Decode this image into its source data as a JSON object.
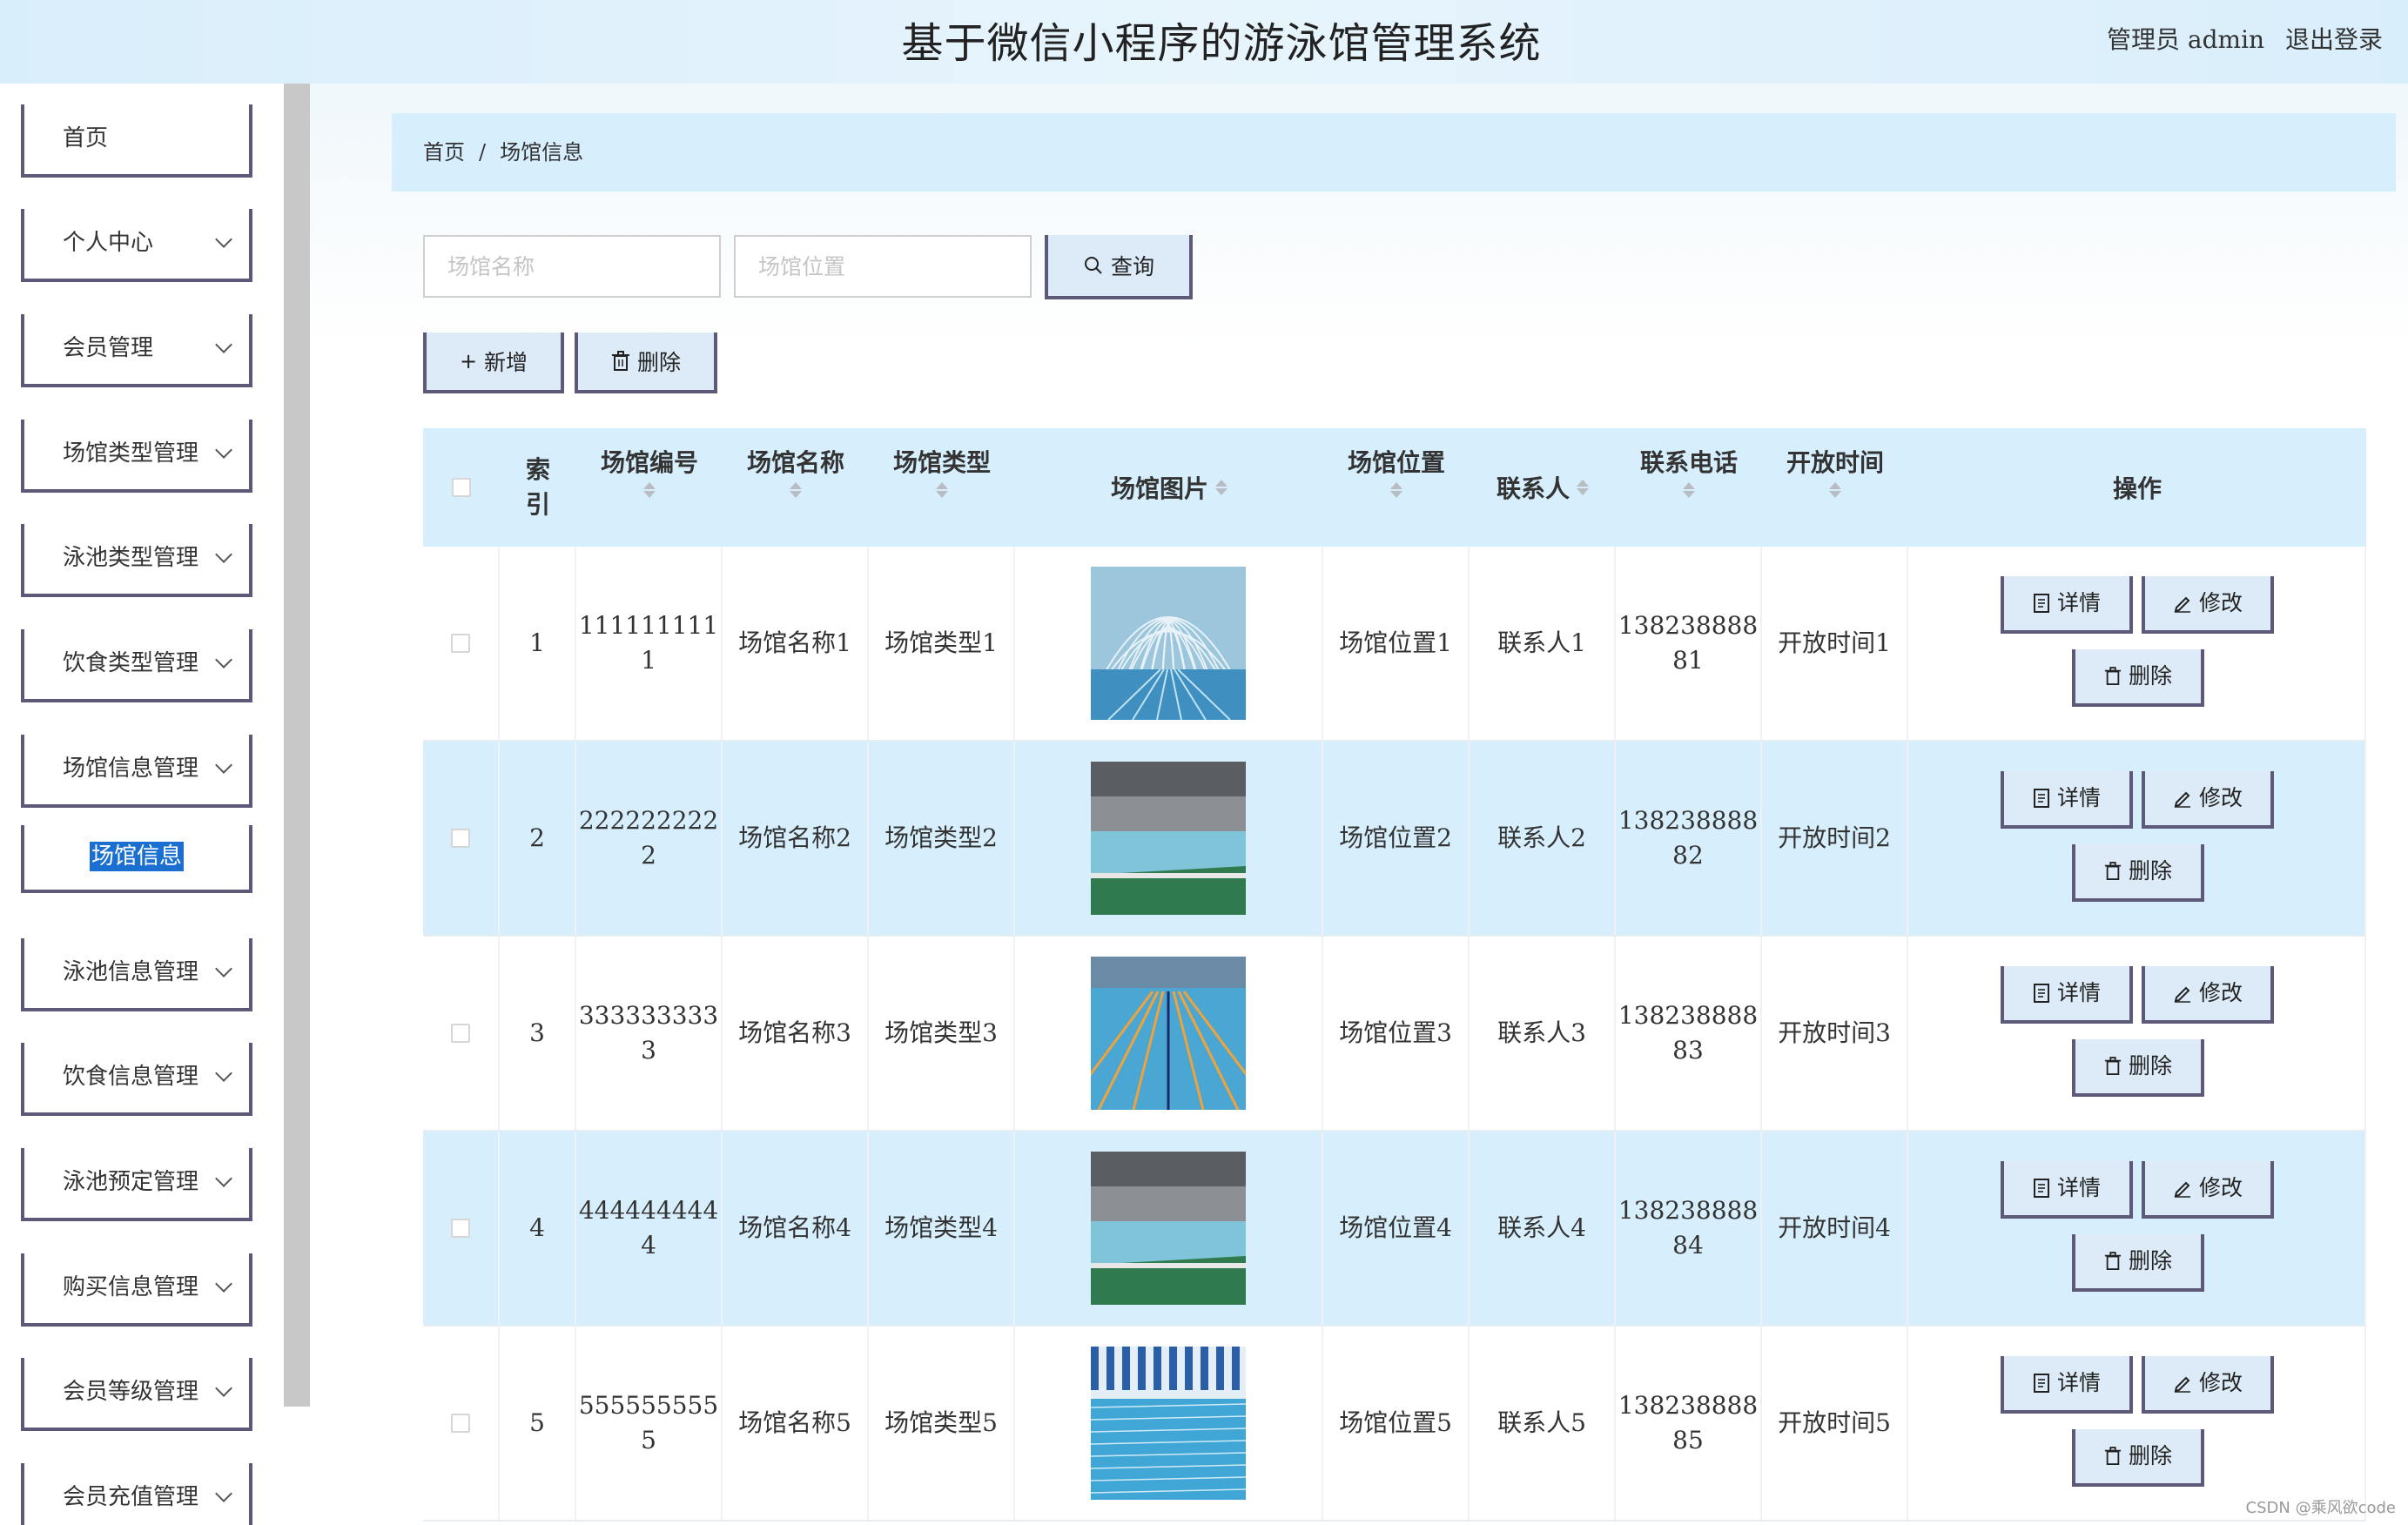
{
  "header": {
    "title": "基于微信小程序的游泳馆管理系统",
    "admin": "管理员 admin",
    "logout": "退出登录"
  },
  "sidebar": {
    "items": [
      {
        "label": "首页"
      },
      {
        "label": "个人中心"
      },
      {
        "label": "会员管理"
      },
      {
        "label": "场馆类型管理"
      },
      {
        "label": "泳池类型管理"
      },
      {
        "label": "饮食类型管理"
      },
      {
        "label": "场馆信息管理"
      },
      {
        "label": "场馆信息"
      },
      {
        "label": "泳池信息管理"
      },
      {
        "label": "饮食信息管理"
      },
      {
        "label": "泳池预定管理"
      },
      {
        "label": "购买信息管理"
      },
      {
        "label": "会员等级管理"
      },
      {
        "label": "会员充值管理"
      }
    ]
  },
  "breadcrumb": {
    "home": "首页",
    "sep": "/",
    "current": "场馆信息"
  },
  "search": {
    "name_placeholder": "场馆名称",
    "location_placeholder": "场馆位置",
    "query_label": "查询"
  },
  "actions": {
    "add_label": "新增",
    "delete_label": "删除"
  },
  "table": {
    "headers": {
      "index": "索\n引",
      "code": "场馆编号",
      "name": "场馆名称",
      "type": "场馆类型",
      "image": "场馆图片",
      "location": "场馆位置",
      "contact": "联系人",
      "phone": "联系电话",
      "hours": "开放时间",
      "ops": "操作"
    },
    "op_labels": {
      "detail": "详情",
      "edit": "修改",
      "delete": "删除"
    },
    "rows": [
      {
        "index": "1",
        "code": "1111111111",
        "name": "场馆名称1",
        "type": "场馆类型1",
        "location": "场馆位置1",
        "contact": "联系人1",
        "phone": "13823888881",
        "hours": "开放时间1",
        "img": "pool-dome"
      },
      {
        "index": "2",
        "code": "2222222222",
        "name": "场馆名称2",
        "type": "场馆类型2",
        "location": "场馆位置2",
        "contact": "联系人2",
        "phone": "13823888882",
        "hours": "开放时间2",
        "img": "pool-indoor-green"
      },
      {
        "index": "3",
        "code": "3333333333",
        "name": "场馆名称3",
        "type": "场馆类型3",
        "location": "场馆位置3",
        "contact": "联系人3",
        "phone": "13823888883",
        "hours": "开放时间3",
        "img": "pool-lanes"
      },
      {
        "index": "4",
        "code": "4444444444",
        "name": "场馆名称4",
        "type": "场馆类型4",
        "location": "场馆位置4",
        "contact": "联系人4",
        "phone": "13823888884",
        "hours": "开放时间4",
        "img": "pool-indoor-green"
      },
      {
        "index": "5",
        "code": "5555555555",
        "name": "场馆名称5",
        "type": "场馆类型5",
        "location": "场馆位置5",
        "contact": "联系人5",
        "phone": "13823888885",
        "hours": "开放时间5",
        "img": "pool-swimmers"
      }
    ]
  },
  "watermark": "CSDN @乘风欲code",
  "colors": {
    "accent_bg": "#d7effd",
    "button_border": "#5c5a78",
    "selected": "#1a6fd0"
  }
}
